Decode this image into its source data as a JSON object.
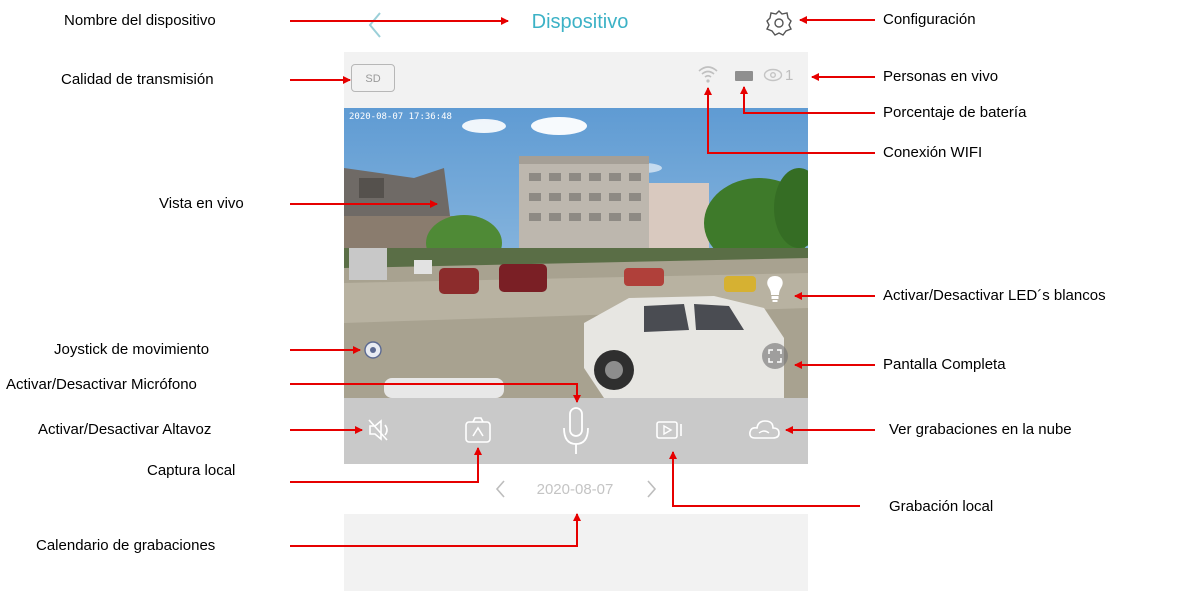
{
  "app": {
    "title": "Dispositivo",
    "quality_badge": "SD",
    "viewers_count": "1",
    "timestamp": "2020-08-07 17:36:48",
    "date": "2020-08-07",
    "icons": {
      "back": "chevron-left-icon",
      "settings": "gear-icon",
      "wifi": "wifi-icon",
      "battery": "battery-icon",
      "viewers": "eye-icon",
      "joystick": "joystick-icon",
      "led": "lightbulb-icon",
      "fullscreen": "fullscreen-icon",
      "speaker": "speaker-muted-icon",
      "capture": "camera-icon",
      "microphone": "microphone-icon",
      "record": "video-record-icon",
      "cloud": "cloud-icon",
      "prev_date": "chevron-left-icon",
      "next_date": "chevron-right-icon"
    },
    "colors": {
      "accent": "#3cb2c6",
      "annotation": "#e60000"
    }
  },
  "annotations": {
    "device_name": "Nombre del dispositivo",
    "settings": "Configuración",
    "stream_quality": "Calidad de transmisión",
    "live_viewers": "Personas en vivo",
    "battery": "Porcentaje de batería",
    "wifi": "Conexión WIFI",
    "live_view": "Vista en vivo",
    "led": "Activar/Desactivar LED´s blancos",
    "joystick": "Joystick de movimiento",
    "fullscreen": "Pantalla Completa",
    "microphone": "Activar/Desactivar Micrófono",
    "speaker": "Activar/Desactivar Altavoz",
    "cloud": "Ver grabaciones en la nube",
    "capture": "Captura local",
    "local_record": "Grabación local",
    "calendar": "Calendario de grabaciones"
  }
}
